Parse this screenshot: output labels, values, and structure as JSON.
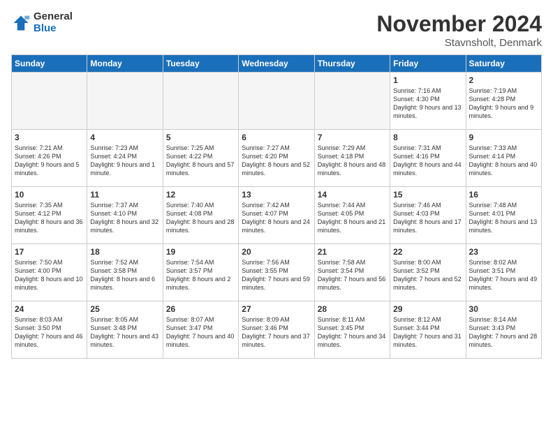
{
  "logo": {
    "general": "General",
    "blue": "Blue"
  },
  "header": {
    "month": "November 2024",
    "location": "Stavnsholt, Denmark"
  },
  "weekdays": [
    "Sunday",
    "Monday",
    "Tuesday",
    "Wednesday",
    "Thursday",
    "Friday",
    "Saturday"
  ],
  "weeks": [
    [
      {
        "day": "",
        "sunrise": "",
        "sunset": "",
        "daylight": ""
      },
      {
        "day": "",
        "sunrise": "",
        "sunset": "",
        "daylight": ""
      },
      {
        "day": "",
        "sunrise": "",
        "sunset": "",
        "daylight": ""
      },
      {
        "day": "",
        "sunrise": "",
        "sunset": "",
        "daylight": ""
      },
      {
        "day": "",
        "sunrise": "",
        "sunset": "",
        "daylight": ""
      },
      {
        "day": "1",
        "sunrise": "Sunrise: 7:16 AM",
        "sunset": "Sunset: 4:30 PM",
        "daylight": "Daylight: 9 hours and 13 minutes."
      },
      {
        "day": "2",
        "sunrise": "Sunrise: 7:19 AM",
        "sunset": "Sunset: 4:28 PM",
        "daylight": "Daylight: 9 hours and 9 minutes."
      }
    ],
    [
      {
        "day": "3",
        "sunrise": "Sunrise: 7:21 AM",
        "sunset": "Sunset: 4:26 PM",
        "daylight": "Daylight: 9 hours and 5 minutes."
      },
      {
        "day": "4",
        "sunrise": "Sunrise: 7:23 AM",
        "sunset": "Sunset: 4:24 PM",
        "daylight": "Daylight: 9 hours and 1 minute."
      },
      {
        "day": "5",
        "sunrise": "Sunrise: 7:25 AM",
        "sunset": "Sunset: 4:22 PM",
        "daylight": "Daylight: 8 hours and 57 minutes."
      },
      {
        "day": "6",
        "sunrise": "Sunrise: 7:27 AM",
        "sunset": "Sunset: 4:20 PM",
        "daylight": "Daylight: 8 hours and 52 minutes."
      },
      {
        "day": "7",
        "sunrise": "Sunrise: 7:29 AM",
        "sunset": "Sunset: 4:18 PM",
        "daylight": "Daylight: 8 hours and 48 minutes."
      },
      {
        "day": "8",
        "sunrise": "Sunrise: 7:31 AM",
        "sunset": "Sunset: 4:16 PM",
        "daylight": "Daylight: 8 hours and 44 minutes."
      },
      {
        "day": "9",
        "sunrise": "Sunrise: 7:33 AM",
        "sunset": "Sunset: 4:14 PM",
        "daylight": "Daylight: 8 hours and 40 minutes."
      }
    ],
    [
      {
        "day": "10",
        "sunrise": "Sunrise: 7:35 AM",
        "sunset": "Sunset: 4:12 PM",
        "daylight": "Daylight: 8 hours and 36 minutes."
      },
      {
        "day": "11",
        "sunrise": "Sunrise: 7:37 AM",
        "sunset": "Sunset: 4:10 PM",
        "daylight": "Daylight: 8 hours and 32 minutes."
      },
      {
        "day": "12",
        "sunrise": "Sunrise: 7:40 AM",
        "sunset": "Sunset: 4:08 PM",
        "daylight": "Daylight: 8 hours and 28 minutes."
      },
      {
        "day": "13",
        "sunrise": "Sunrise: 7:42 AM",
        "sunset": "Sunset: 4:07 PM",
        "daylight": "Daylight: 8 hours and 24 minutes."
      },
      {
        "day": "14",
        "sunrise": "Sunrise: 7:44 AM",
        "sunset": "Sunset: 4:05 PM",
        "daylight": "Daylight: 8 hours and 21 minutes."
      },
      {
        "day": "15",
        "sunrise": "Sunrise: 7:46 AM",
        "sunset": "Sunset: 4:03 PM",
        "daylight": "Daylight: 8 hours and 17 minutes."
      },
      {
        "day": "16",
        "sunrise": "Sunrise: 7:48 AM",
        "sunset": "Sunset: 4:01 PM",
        "daylight": "Daylight: 8 hours and 13 minutes."
      }
    ],
    [
      {
        "day": "17",
        "sunrise": "Sunrise: 7:50 AM",
        "sunset": "Sunset: 4:00 PM",
        "daylight": "Daylight: 8 hours and 10 minutes."
      },
      {
        "day": "18",
        "sunrise": "Sunrise: 7:52 AM",
        "sunset": "Sunset: 3:58 PM",
        "daylight": "Daylight: 8 hours and 6 minutes."
      },
      {
        "day": "19",
        "sunrise": "Sunrise: 7:54 AM",
        "sunset": "Sunset: 3:57 PM",
        "daylight": "Daylight: 8 hours and 2 minutes."
      },
      {
        "day": "20",
        "sunrise": "Sunrise: 7:56 AM",
        "sunset": "Sunset: 3:55 PM",
        "daylight": "Daylight: 7 hours and 59 minutes."
      },
      {
        "day": "21",
        "sunrise": "Sunrise: 7:58 AM",
        "sunset": "Sunset: 3:54 PM",
        "daylight": "Daylight: 7 hours and 56 minutes."
      },
      {
        "day": "22",
        "sunrise": "Sunrise: 8:00 AM",
        "sunset": "Sunset: 3:52 PM",
        "daylight": "Daylight: 7 hours and 52 minutes."
      },
      {
        "day": "23",
        "sunrise": "Sunrise: 8:02 AM",
        "sunset": "Sunset: 3:51 PM",
        "daylight": "Daylight: 7 hours and 49 minutes."
      }
    ],
    [
      {
        "day": "24",
        "sunrise": "Sunrise: 8:03 AM",
        "sunset": "Sunset: 3:50 PM",
        "daylight": "Daylight: 7 hours and 46 minutes."
      },
      {
        "day": "25",
        "sunrise": "Sunrise: 8:05 AM",
        "sunset": "Sunset: 3:48 PM",
        "daylight": "Daylight: 7 hours and 43 minutes."
      },
      {
        "day": "26",
        "sunrise": "Sunrise: 8:07 AM",
        "sunset": "Sunset: 3:47 PM",
        "daylight": "Daylight: 7 hours and 40 minutes."
      },
      {
        "day": "27",
        "sunrise": "Sunrise: 8:09 AM",
        "sunset": "Sunset: 3:46 PM",
        "daylight": "Daylight: 7 hours and 37 minutes."
      },
      {
        "day": "28",
        "sunrise": "Sunrise: 8:11 AM",
        "sunset": "Sunset: 3:45 PM",
        "daylight": "Daylight: 7 hours and 34 minutes."
      },
      {
        "day": "29",
        "sunrise": "Sunrise: 8:12 AM",
        "sunset": "Sunset: 3:44 PM",
        "daylight": "Daylight: 7 hours and 31 minutes."
      },
      {
        "day": "30",
        "sunrise": "Sunrise: 8:14 AM",
        "sunset": "Sunset: 3:43 PM",
        "daylight": "Daylight: 7 hours and 28 minutes."
      }
    ]
  ]
}
